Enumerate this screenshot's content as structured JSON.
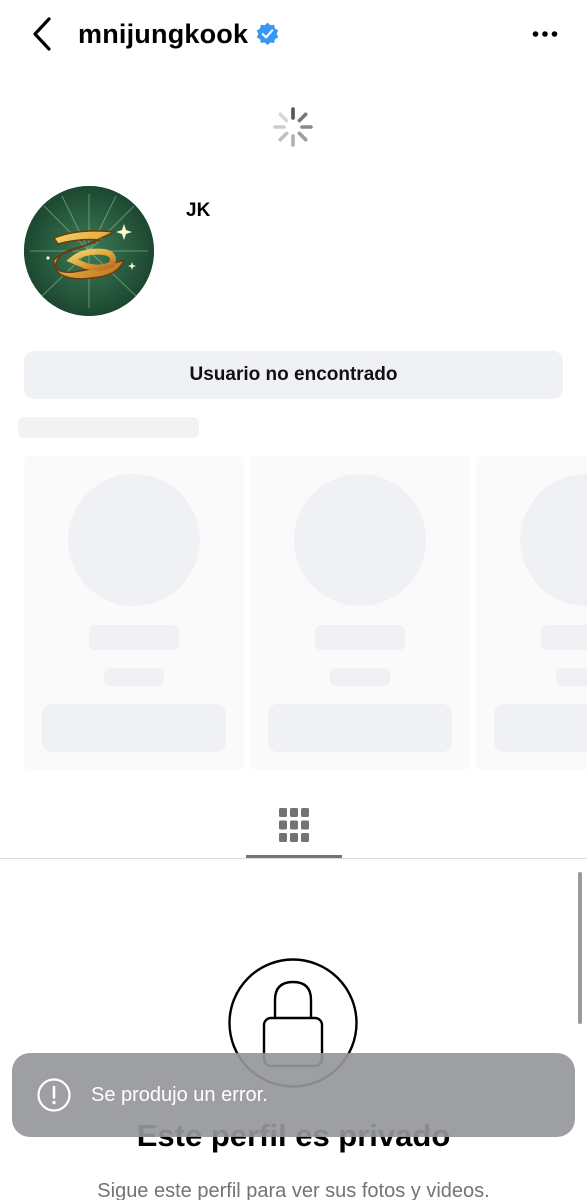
{
  "header": {
    "back_icon": "chevron-left-icon",
    "username": "mnijungkook",
    "verified_icon": "verified-badge-icon",
    "verified_color": "#3897f0",
    "more_icon": "more-horizontal-icon"
  },
  "loading": {
    "icon": "spinner-icon"
  },
  "profile": {
    "display_name": "JK",
    "avatar_icon": "avatar-logo"
  },
  "primary_button": {
    "label": "Usuario no encontrado"
  },
  "tabs": [
    {
      "icon": "grid-icon",
      "active": true
    }
  ],
  "private_section": {
    "icon": "lock-icon",
    "title": "Este perfil es privado",
    "subtitle": "Sigue este perfil para ver sus fotos y videos."
  },
  "toast": {
    "icon": "alert-circle-icon",
    "message": "Se produjo un error."
  },
  "colors": {
    "skeleton": "#eff1f4",
    "button_bg": "#eff1f4",
    "toast_bg": "#96979b",
    "avatar_bg": "#1f4f38"
  }
}
